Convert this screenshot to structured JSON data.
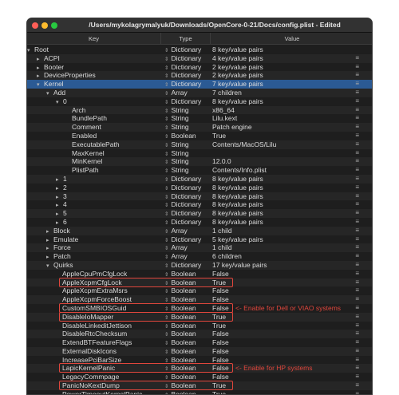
{
  "window": {
    "title": "/Users/mykolagrymalyuk/Downloads/OpenCore-0-21/Docs/config.plist - Edited"
  },
  "columns": {
    "key": "Key",
    "type": "Type",
    "value": "Value"
  },
  "icons": {
    "sort_arrows": "up-down-arrows-icon",
    "row_menu": "hamburger-menu-icon",
    "disclosure": "disclosure-triangle-icon"
  },
  "colors": {
    "selection": "#2b5a94",
    "highlight": "#e0463c"
  },
  "rows": [
    {
      "key": "Root",
      "type": "Dictionary",
      "value": "8 key/value pairs",
      "indent": 0,
      "arrow": "▾",
      "menu": false
    },
    {
      "key": "ACPI",
      "type": "Dictionary",
      "value": "4 key/value pairs",
      "indent": 1,
      "arrow": "▸",
      "menu": true
    },
    {
      "key": "Booter",
      "type": "Dictionary",
      "value": "2 key/value pairs",
      "indent": 1,
      "arrow": "▸",
      "menu": true
    },
    {
      "key": "DeviceProperties",
      "type": "Dictionary",
      "value": "2 key/value pairs",
      "indent": 1,
      "arrow": "▸",
      "menu": true
    },
    {
      "key": "Kernel",
      "type": "Dictionary",
      "value": "7 key/value pairs",
      "indent": 1,
      "arrow": "▾",
      "menu": true,
      "selected": true
    },
    {
      "key": "Add",
      "type": "Array",
      "value": "7 children",
      "indent": 2,
      "arrow": "▾",
      "menu": true
    },
    {
      "key": "0",
      "type": "Dictionary",
      "value": "8 key/value pairs",
      "indent": 3,
      "arrow": "▾",
      "menu": true
    },
    {
      "key": "Arch",
      "type": "String",
      "value": "x86_64",
      "indent": 4,
      "arrow": "",
      "menu": true
    },
    {
      "key": "BundlePath",
      "type": "String",
      "value": "Lilu.kext",
      "indent": 4,
      "arrow": "",
      "menu": true
    },
    {
      "key": "Comment",
      "type": "String",
      "value": "Patch engine",
      "indent": 4,
      "arrow": "",
      "menu": true
    },
    {
      "key": "Enabled",
      "type": "Boolean",
      "value": "True",
      "indent": 4,
      "arrow": "",
      "menu": true
    },
    {
      "key": "ExecutablePath",
      "type": "String",
      "value": "Contents/MacOS/Lilu",
      "indent": 4,
      "arrow": "",
      "menu": true
    },
    {
      "key": "MaxKernel",
      "type": "String",
      "value": "",
      "indent": 4,
      "arrow": "",
      "menu": true
    },
    {
      "key": "MinKernel",
      "type": "String",
      "value": "12.0.0",
      "indent": 4,
      "arrow": "",
      "menu": true
    },
    {
      "key": "PlistPath",
      "type": "String",
      "value": "Contents/Info.plist",
      "indent": 4,
      "arrow": "",
      "menu": true
    },
    {
      "key": "1",
      "type": "Dictionary",
      "value": "8 key/value pairs",
      "indent": 3,
      "arrow": "▸",
      "menu": true
    },
    {
      "key": "2",
      "type": "Dictionary",
      "value": "8 key/value pairs",
      "indent": 3,
      "arrow": "▸",
      "menu": true
    },
    {
      "key": "3",
      "type": "Dictionary",
      "value": "8 key/value pairs",
      "indent": 3,
      "arrow": "▸",
      "menu": true
    },
    {
      "key": "4",
      "type": "Dictionary",
      "value": "8 key/value pairs",
      "indent": 3,
      "arrow": "▸",
      "menu": true
    },
    {
      "key": "5",
      "type": "Dictionary",
      "value": "8 key/value pairs",
      "indent": 3,
      "arrow": "▸",
      "menu": true
    },
    {
      "key": "6",
      "type": "Dictionary",
      "value": "8 key/value pairs",
      "indent": 3,
      "arrow": "▸",
      "menu": true
    },
    {
      "key": "Block",
      "type": "Array",
      "value": "1 child",
      "indent": 2,
      "arrow": "▸",
      "menu": true
    },
    {
      "key": "Emulate",
      "type": "Dictionary",
      "value": "5 key/value pairs",
      "indent": 2,
      "arrow": "▸",
      "menu": true
    },
    {
      "key": "Force",
      "type": "Array",
      "value": "1 child",
      "indent": 2,
      "arrow": "▸",
      "menu": true
    },
    {
      "key": "Patch",
      "type": "Array",
      "value": "6 children",
      "indent": 2,
      "arrow": "▸",
      "menu": true
    },
    {
      "key": "Quirks",
      "type": "Dictionary",
      "value": "17 key/value pairs",
      "indent": 2,
      "arrow": "▾",
      "menu": true
    },
    {
      "key": "AppleCpuPmCfgLock",
      "type": "Boolean",
      "value": "False",
      "indent": 3,
      "arrow": "",
      "menu": true
    },
    {
      "key": "AppleXcpmCfgLock",
      "type": "Boolean",
      "value": "True",
      "indent": 3,
      "arrow": "",
      "menu": true
    },
    {
      "key": "AppleXcpmExtraMsrs",
      "type": "Boolean",
      "value": "False",
      "indent": 3,
      "arrow": "",
      "menu": true
    },
    {
      "key": "AppleXcpmForceBoost",
      "type": "Boolean",
      "value": "False",
      "indent": 3,
      "arrow": "",
      "menu": true
    },
    {
      "key": "CustomSMBIOSGuid",
      "type": "Boolean",
      "value": "False",
      "indent": 3,
      "arrow": "",
      "menu": true
    },
    {
      "key": "DisableIoMapper",
      "type": "Boolean",
      "value": "True",
      "indent": 3,
      "arrow": "",
      "menu": true
    },
    {
      "key": "DisableLinkeditJettison",
      "type": "Boolean",
      "value": "True",
      "indent": 3,
      "arrow": "",
      "menu": true
    },
    {
      "key": "DisableRtcChecksum",
      "type": "Boolean",
      "value": "False",
      "indent": 3,
      "arrow": "",
      "menu": true
    },
    {
      "key": "ExtendBTFeatureFlags",
      "type": "Boolean",
      "value": "False",
      "indent": 3,
      "arrow": "",
      "menu": true
    },
    {
      "key": "ExternalDiskIcons",
      "type": "Boolean",
      "value": "False",
      "indent": 3,
      "arrow": "",
      "menu": true
    },
    {
      "key": "IncreasePciBarSize",
      "type": "Boolean",
      "value": "False",
      "indent": 3,
      "arrow": "",
      "menu": true
    },
    {
      "key": "LapicKernelPanic",
      "type": "Boolean",
      "value": "False",
      "indent": 3,
      "arrow": "",
      "menu": true
    },
    {
      "key": "LegacyCommpage",
      "type": "Boolean",
      "value": "False",
      "indent": 3,
      "arrow": "",
      "menu": true
    },
    {
      "key": "PanicNoKextDump",
      "type": "Boolean",
      "value": "True",
      "indent": 3,
      "arrow": "",
      "menu": true
    },
    {
      "key": "PowerTimeoutKernelPanic",
      "type": "Boolean",
      "value": "True",
      "indent": 3,
      "arrow": "",
      "menu": true
    }
  ],
  "annotations": {
    "dell_viao": "<- Enable for Dell or VIAO systems",
    "hp": "<- Enable for HP systems"
  }
}
